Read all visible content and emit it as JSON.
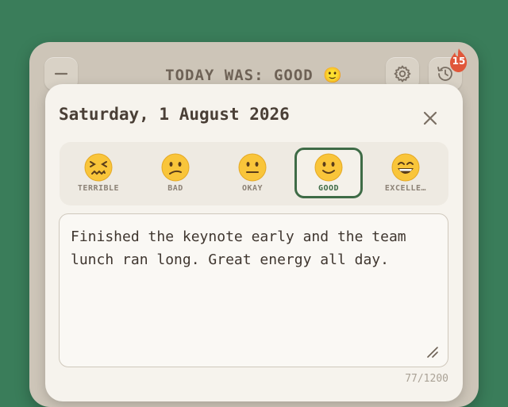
{
  "header": {
    "title": "TODAY WAS: GOOD",
    "title_emoji": "🙂",
    "streak_count": "15"
  },
  "entry": {
    "date": "Saturday, 1 August 2026",
    "note": "Finished the keynote early and the team lunch ran long. Great energy all day.",
    "char_count": "77/1200"
  },
  "moods": [
    {
      "label": "TERRIBLE",
      "icon": "confounded-face-icon"
    },
    {
      "label": "BAD",
      "icon": "confused-face-icon"
    },
    {
      "label": "OKAY",
      "icon": "neutral-face-icon"
    },
    {
      "label": "GOOD",
      "icon": "slightly-smiling-face-icon",
      "selected": true
    },
    {
      "label": "EXCELLE…",
      "icon": "grinning-face-icon"
    }
  ],
  "colors": {
    "background": "#3a7d5a",
    "accent": "#3e6b46",
    "streak": "#e0573a"
  }
}
